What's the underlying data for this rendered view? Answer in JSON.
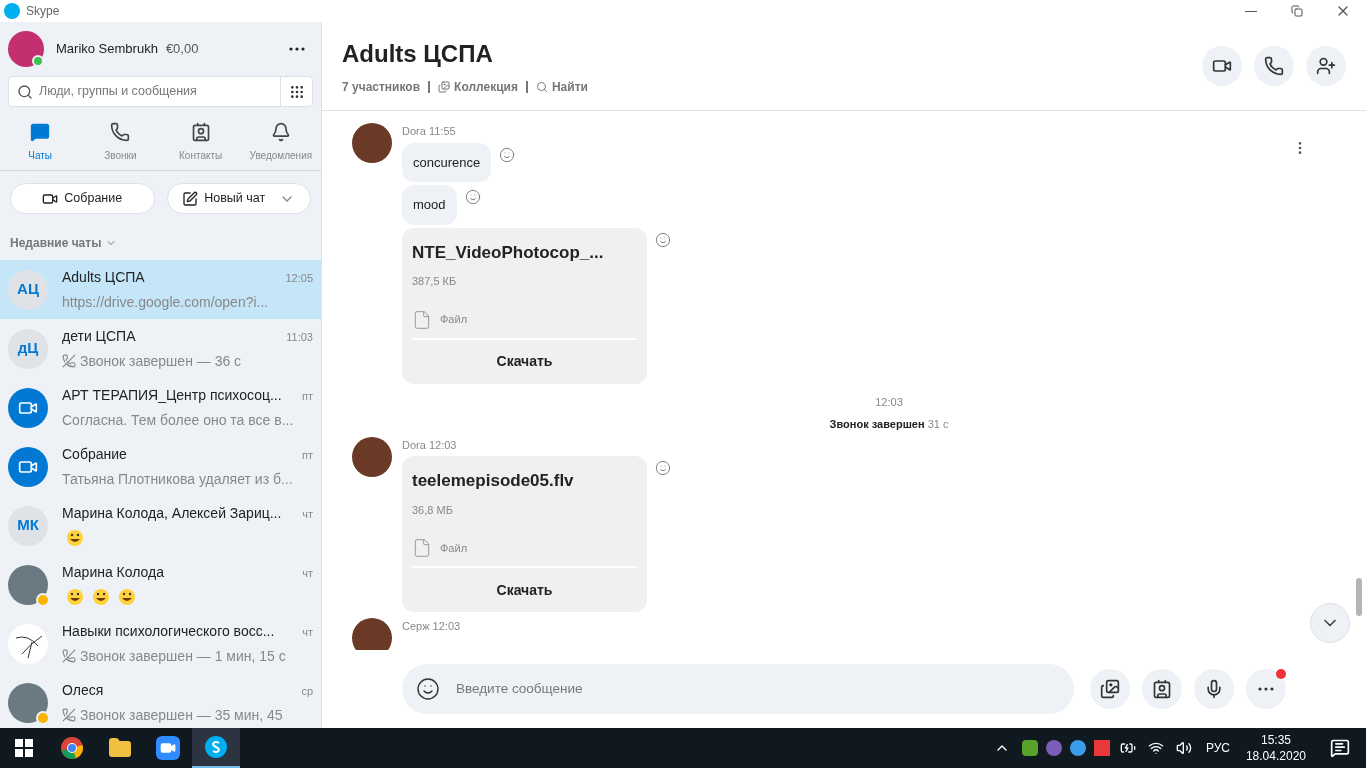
{
  "window": {
    "title": "Skype"
  },
  "profile": {
    "name": "Mariko Sembrukh",
    "balance": "€0,00",
    "online": true
  },
  "search": {
    "placeholder": "Люди, группы и сообщения"
  },
  "nav_tabs": [
    {
      "label": "Чаты",
      "kind": "chats",
      "selected": true
    },
    {
      "label": "Звонки",
      "kind": "calls",
      "selected": false
    },
    {
      "label": "Контакты",
      "kind": "contacts",
      "selected": false
    },
    {
      "label": "Уведомления",
      "kind": "notifications",
      "selected": false
    }
  ],
  "actions": [
    {
      "label": "Собрание",
      "kind": "meeting"
    },
    {
      "label": "Новый чат",
      "kind": "new_chat"
    }
  ],
  "recent_label": "Недавние чаты",
  "chats": [
    {
      "name": "Adults ЦСПА",
      "time": "12:05",
      "avatar": {
        "kind": "initials",
        "text": "АЦ"
      },
      "preview": {
        "kind": "text",
        "text": "https://drive.google.com/open?i..."
      },
      "selected": true
    },
    {
      "name": "дети ЦСПА",
      "time": "11:03",
      "avatar": {
        "kind": "initials",
        "text": "дЦ"
      },
      "preview": {
        "kind": "call",
        "text": "Звонок завершен — 36 с"
      },
      "selected": false
    },
    {
      "name": "АРТ ТЕРАПИЯ_Центр психосоц...",
      "time": "пт",
      "avatar": {
        "kind": "video"
      },
      "preview": {
        "kind": "text",
        "text": "Согласна. Тем более оно та все в..."
      },
      "selected": false
    },
    {
      "name": "Собрание",
      "time": "пт",
      "avatar": {
        "kind": "video"
      },
      "preview": {
        "kind": "text",
        "text": "Татьяна Плотникова удаляет из б..."
      },
      "selected": false
    },
    {
      "name": "Марина Колода, Алексей Зариц...",
      "time": "чт",
      "avatar": {
        "kind": "initials",
        "text": "МК"
      },
      "preview": {
        "kind": "emoji",
        "items": [
          {
            "kind": "laugh"
          }
        ]
      },
      "selected": false
    },
    {
      "name": "Марина Колода",
      "time": "чт",
      "avatar": {
        "kind": "photo",
        "away": true
      },
      "preview": {
        "kind": "emoji",
        "items": [
          {
            "kind": "laugh"
          },
          {
            "kind": "laugh"
          },
          {
            "kind": "laugh"
          }
        ]
      },
      "selected": false
    },
    {
      "name": "Навыки психологического восс...",
      "time": "чт",
      "avatar": {
        "kind": "drawing"
      },
      "preview": {
        "kind": "call",
        "text": "Звонок завершен — 1 мин, 15 с"
      },
      "selected": false
    },
    {
      "name": "Олеся",
      "time": "ср",
      "avatar": {
        "kind": "photo",
        "away": true
      },
      "preview": {
        "kind": "call",
        "text": "Звонок завершен — 35 мин, 45"
      },
      "selected": false
    }
  ],
  "conversation": {
    "title": "Adults ЦСПА",
    "members": "7 участников",
    "gallery": "Коллекция",
    "find": "Найти"
  },
  "messages": [
    {
      "kind": "group",
      "sender": "Dora",
      "time": "11:55",
      "items": [
        {
          "kind": "text",
          "text": "concurence"
        },
        {
          "kind": "text",
          "text": "mood"
        },
        {
          "kind": "file",
          "name": "NTE_VideoPhotocop_...",
          "size": "387,5 КБ",
          "type": "Файл",
          "action": "Скачать"
        }
      ]
    },
    {
      "kind": "event",
      "time": "12:03",
      "title": "Звонок завершен",
      "detail": "31 с"
    },
    {
      "kind": "group",
      "sender": "Dora",
      "time": "12:03",
      "items": [
        {
          "kind": "file",
          "name": "teelemepisode05.flv",
          "size": "36,8 МБ",
          "type": "Файл",
          "action": "Скачать"
        }
      ]
    },
    {
      "kind": "group",
      "sender": "Серж",
      "time": "12:03"
    }
  ],
  "composer": {
    "placeholder": "Введите сообщение"
  },
  "taskbar": {
    "apps": [
      {
        "kind": "windows",
        "selected": false
      },
      {
        "kind": "chrome",
        "selected": false
      },
      {
        "kind": "folder",
        "selected": false
      },
      {
        "kind": "zoom",
        "selected": false
      },
      {
        "kind": "skype",
        "selected": true
      }
    ],
    "language": "РУС",
    "time": "15:35",
    "date": "18.04.2020"
  }
}
